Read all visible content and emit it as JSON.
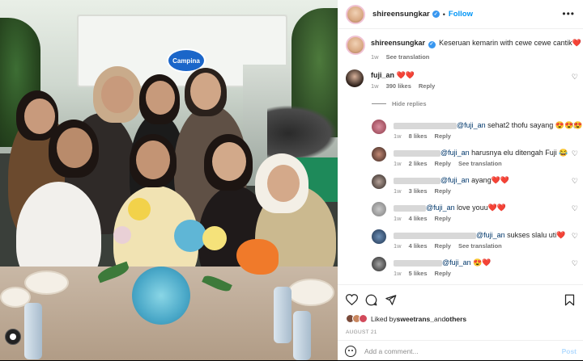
{
  "post": {
    "username": "shireensungkar",
    "follow_label": "Follow",
    "caption_user": "shireensungkar",
    "caption": "Keseruan kemarin with cewe cewe cantik❤️",
    "caption_time": "1w",
    "see_translation": "See translation",
    "photo_sign": "Campina"
  },
  "comments": [
    {
      "user": "fuji_an",
      "text": "❤️❤️",
      "time": "1w",
      "likes": "390 likes",
      "reply": "Reply",
      "hide_replies": "Hide replies"
    }
  ],
  "replies": [
    {
      "mention": "@fuji_an",
      "text": " sehat2 thofu sayang 😍😍😍",
      "time": "1w",
      "likes": "8 likes",
      "reply": "Reply",
      "translation": ""
    },
    {
      "mention": "@fuji_an",
      "text": " harusnya elu ditengah Fuji 😂",
      "time": "1w",
      "likes": "2 likes",
      "reply": "Reply",
      "translation": "See translation"
    },
    {
      "mention": "@fuji_an",
      "text": " ayang❤️❤️",
      "time": "1w",
      "likes": "3 likes",
      "reply": "Reply",
      "translation": ""
    },
    {
      "mention": "@fuji_an",
      "text": " love youu❤️❤️",
      "time": "1w",
      "likes": "4 likes",
      "reply": "Reply",
      "translation": ""
    },
    {
      "mention": "@fuji_an",
      "text": " sukses slalu uti❤️",
      "time": "1w",
      "likes": "4 likes",
      "reply": "Reply",
      "translation": "See translation"
    },
    {
      "mention": "@fuji_an",
      "text": " 😍❤️",
      "time": "1w",
      "likes": "5 likes",
      "reply": "Reply",
      "translation": ""
    }
  ],
  "likes": {
    "prefix": "Liked by ",
    "user": "sweetrans_",
    "and": " and ",
    "others": "others"
  },
  "date": "AUGUST 21",
  "add_comment": {
    "placeholder": "Add a comment...",
    "post_label": "Post"
  },
  "colors": {
    "accent": "#0095f6",
    "verified": "#3897f0",
    "heart_red": "#ed4956",
    "muted": "#8e8e8e"
  },
  "icons": [
    "verified-icon",
    "more-icon",
    "heart-icon",
    "comment-icon",
    "share-icon",
    "bookmark-icon",
    "emoji-icon"
  ]
}
